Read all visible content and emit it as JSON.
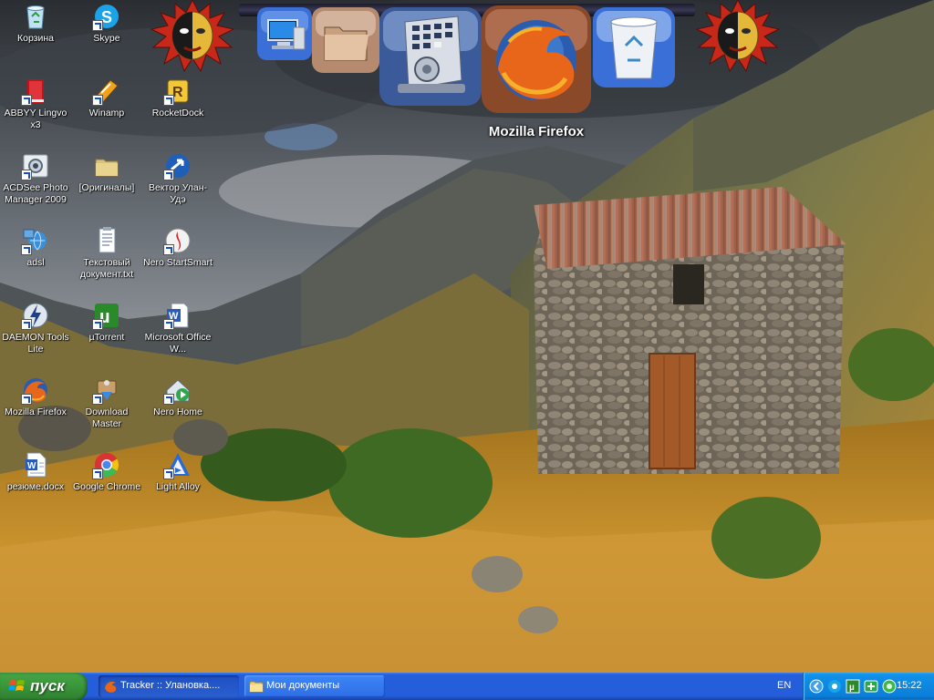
{
  "desktop": {
    "icons": [
      {
        "label": "Корзина",
        "icon": "recycle-bin-icon"
      },
      {
        "label": "Skype",
        "icon": "skype-icon"
      },
      {
        "label": "ABBYY Lingvo x3",
        "icon": "book-icon"
      },
      {
        "label": "Winamp",
        "icon": "winamp-icon"
      },
      {
        "label": "RocketDock",
        "icon": "rocketdock-icon"
      },
      {
        "label": "ACDSee Photo Manager 2009",
        "icon": "acdsee-icon"
      },
      {
        "label": "[Оригиналы]",
        "icon": "folder-icon"
      },
      {
        "label": "Вектор Улан-Удэ",
        "icon": "vector-icon"
      },
      {
        "label": "adsl",
        "icon": "network-icon"
      },
      {
        "label": "Текстовый документ.txt",
        "icon": "text-document-icon"
      },
      {
        "label": "Nero StartSmart",
        "icon": "nero-icon"
      },
      {
        "label": "DAEMON Tools Lite",
        "icon": "daemon-tools-icon"
      },
      {
        "label": "µTorrent",
        "icon": "utorrent-icon"
      },
      {
        "label": "Microsoft Office W...",
        "icon": "word-icon"
      },
      {
        "label": "Mozilla Firefox",
        "icon": "firefox-icon"
      },
      {
        "label": "Download Master",
        "icon": "download-master-icon"
      },
      {
        "label": "Nero Home",
        "icon": "nero-home-icon"
      },
      {
        "label": "резюме.docx",
        "icon": "docx-icon"
      },
      {
        "label": "Google Chrome",
        "icon": "chrome-icon"
      },
      {
        "label": "Light Alloy",
        "icon": "light-alloy-icon"
      }
    ]
  },
  "dock": {
    "hover_label": "Mozilla Firefox",
    "items": [
      "my-computer-icon",
      "folder-icon",
      "control-panel-icon",
      "firefox-icon",
      "recycle-bin-icon"
    ]
  },
  "taskbar": {
    "start_label": "пуск",
    "tasks": [
      {
        "label": "Tracker :: Улановка....",
        "icon": "firefox-icon",
        "active": true
      },
      {
        "label": "Мои документы",
        "icon": "folder-icon",
        "active": false
      }
    ],
    "language": "EN",
    "clock": "15:22"
  },
  "colors": {
    "taskbar_blue": "#245edb",
    "start_green": "#3c9a3c",
    "tray_blue": "#0b7fd9"
  }
}
